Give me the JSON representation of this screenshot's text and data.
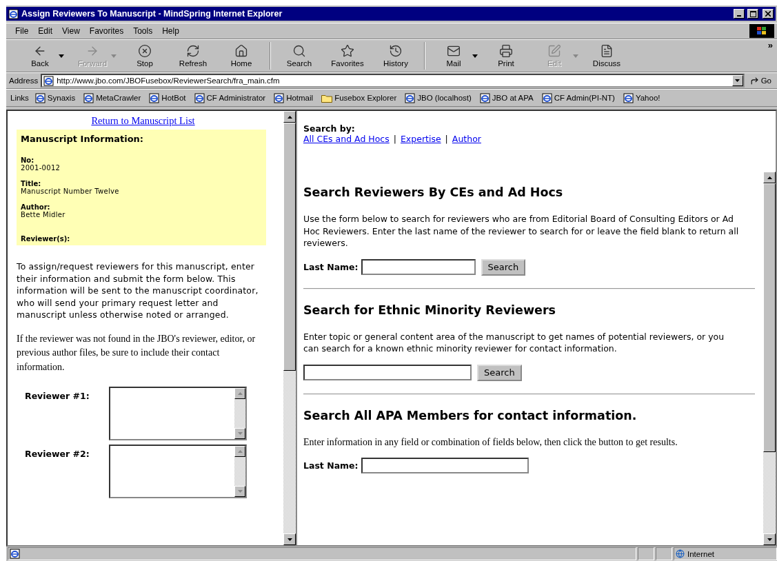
{
  "window": {
    "title": "Assign Reviewers To Manuscript - MindSpring Internet Explorer"
  },
  "menu": [
    {
      "label": "File"
    },
    {
      "label": "Edit"
    },
    {
      "label": "View"
    },
    {
      "label": "Favorites"
    },
    {
      "label": "Tools"
    },
    {
      "label": "Help"
    }
  ],
  "toolbar": {
    "buttons": [
      {
        "label": "Back",
        "disabled": false,
        "dropdown": true
      },
      {
        "label": "Forward",
        "disabled": true,
        "dropdown": true
      },
      {
        "label": "Stop",
        "disabled": false,
        "dropdown": false
      },
      {
        "label": "Refresh",
        "disabled": false,
        "dropdown": false
      },
      {
        "label": "Home",
        "disabled": false,
        "dropdown": false
      },
      {
        "label": "Search",
        "disabled": false,
        "dropdown": false
      },
      {
        "label": "Favorites",
        "disabled": false,
        "dropdown": false
      },
      {
        "label": "History",
        "disabled": false,
        "dropdown": false
      },
      {
        "label": "Mail",
        "disabled": false,
        "dropdown": true
      },
      {
        "label": "Print",
        "disabled": false,
        "dropdown": false
      },
      {
        "label": "Edit",
        "disabled": true,
        "dropdown": true
      },
      {
        "label": "Discuss",
        "disabled": false,
        "dropdown": false
      }
    ],
    "more": "»"
  },
  "address": {
    "label": "Address",
    "url": "http://www.jbo.com/JBOFusebox/ReviewerSearch/fra_main.cfm",
    "go": "Go"
  },
  "links": {
    "label": "Links",
    "items": [
      {
        "label": "Synaxis",
        "kind": "page"
      },
      {
        "label": "MetaCrawler",
        "kind": "page"
      },
      {
        "label": "HotBot",
        "kind": "page"
      },
      {
        "label": "CF Administrator",
        "kind": "page"
      },
      {
        "label": "Hotmail",
        "kind": "page"
      },
      {
        "label": "Fusebox Explorer",
        "kind": "folder"
      },
      {
        "label": "JBO (localhost)",
        "kind": "page"
      },
      {
        "label": "JBO at APA",
        "kind": "page"
      },
      {
        "label": "CF Admin(PI-NT)",
        "kind": "page"
      },
      {
        "label": "Yahoo!",
        "kind": "page"
      }
    ]
  },
  "left": {
    "return_link": "Return to Manuscript List",
    "info": {
      "heading": "Manuscript Information:",
      "fields": [
        {
          "label": "No:",
          "value": "2001-0012"
        },
        {
          "label": "Title:",
          "value": "Manuscript Number Twelve"
        },
        {
          "label": "Author:",
          "value": "Bette Midler"
        },
        {
          "label": "Reviewer(s):"
        }
      ]
    },
    "instructions": "To assign/request reviewers for this manuscript, enter their information and submit the form below. This information will be sent to the manuscript coordinator, who will send your primary request letter and manuscript unless otherwise noted or arranged.",
    "note": "If the reviewer was not found in the JBO's reviewer, editor, or previous author files, be sure to include their contact information.",
    "reviewers": [
      {
        "label": "Reviewer #1:"
      },
      {
        "label": "Reviewer #2:"
      }
    ]
  },
  "right": {
    "search_by": "Search by:",
    "separator": "|",
    "search_links": [
      "All CEs and Ad Hocs",
      "Expertise",
      "Author"
    ],
    "sections": [
      {
        "kind": "sans",
        "heading": "Search Reviewers By CEs and Ad Hocs",
        "text": "Use the form below to search for reviewers who are from Editorial Board of Consulting Editors or Ad Hoc Reviewers.  Enter the last name of the reviewer to search for or leave the field blank to return all reviewers.",
        "field_label": "Last Name:",
        "button": "Search"
      },
      {
        "kind": "sans",
        "heading": "Search for Ethnic Minority Reviewers",
        "text": "Enter topic or general content area of the manuscript to get names of potential reviewers, or you can search for a known ethnic minority reviewer for contact information.",
        "button": "Search"
      },
      {
        "kind": "serif",
        "heading": "Search All APA Members for contact information.",
        "text": "Enter information in any field or combination of fields below, then click the button to get results.",
        "field_label": "Last Name:"
      }
    ]
  },
  "status_bar": {
    "zone": "Internet"
  }
}
